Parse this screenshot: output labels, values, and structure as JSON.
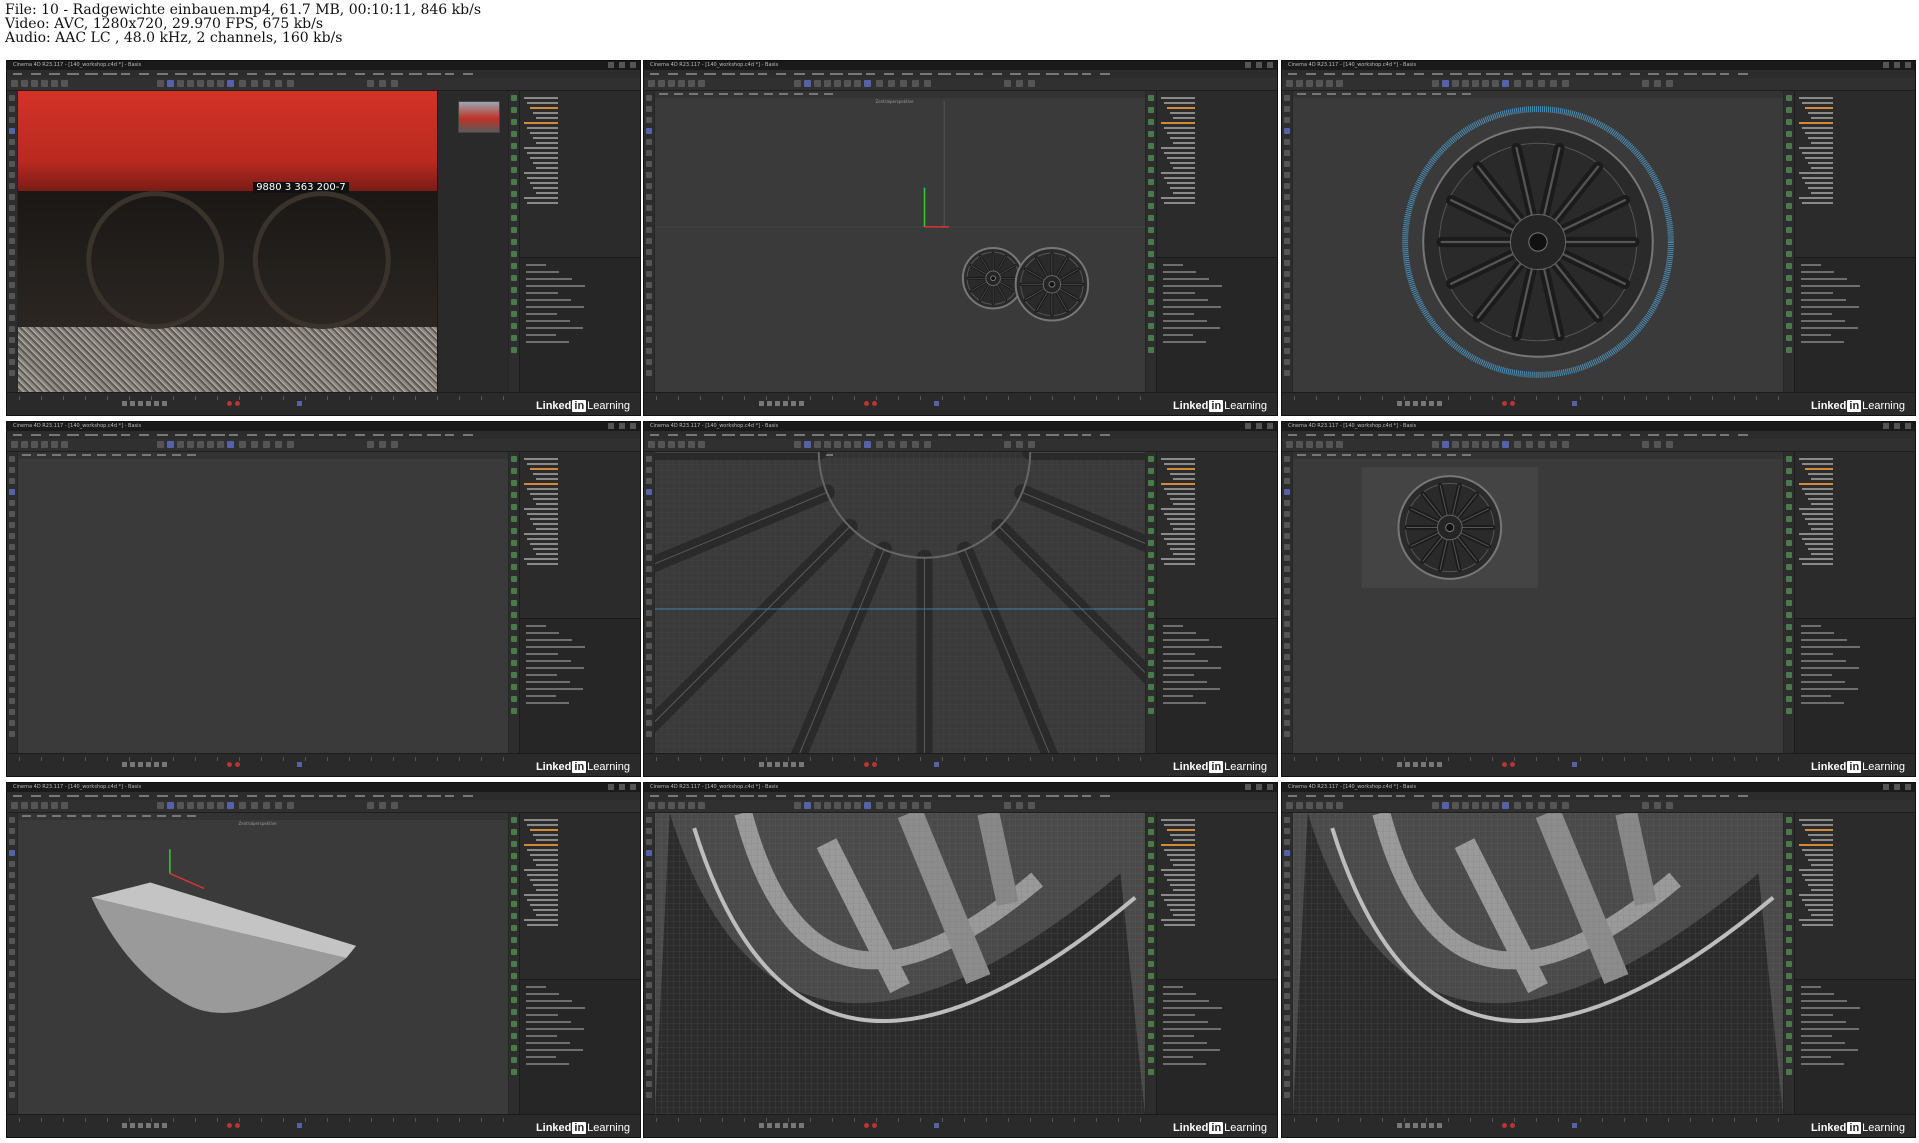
{
  "file_info": {
    "line1": "File: 10 - Radgewichte einbauen.mp4, 61.7 MB, 00:10:11, 846 kb/s",
    "line2": "Video: AVC, 1280x720, 29.970 FPS, 675 kb/s",
    "line3": "Audio: AAC LC , 48.0 kHz, 2 channels, 160 kb/s"
  },
  "watermark": {
    "brand_left": "Linked",
    "brand_box": "in",
    "brand_right": "Learning"
  },
  "frames": [
    {
      "id": "frame-1",
      "title": "Cinema 4D R23.117 - [140_workshop.c4d *] - Basis",
      "scene": "photo-reference",
      "label": ""
    },
    {
      "id": "frame-2",
      "title": "Cinema 4D R23.117 - [140_workshop.c4d *] - Basis",
      "scene": "two-wheels",
      "label": "Zentralperspektive"
    },
    {
      "id": "frame-3",
      "title": "Cinema 4D R23.117 - [140_workshop.c4d *] - Basis",
      "scene": "wheel-front",
      "label": ""
    },
    {
      "id": "frame-4",
      "title": "Cinema 4D R23.117 - [140_workshop.c4d *] - Basis",
      "scene": "empty",
      "label": ""
    },
    {
      "id": "frame-5",
      "title": "Cinema 4D R23.117 - [140_workshop.c4d *] - Basis",
      "scene": "wheel-closeup",
      "label": ""
    },
    {
      "id": "frame-6",
      "title": "Cinema 4D R23.117 - [140_workshop.c4d *] - Basis",
      "scene": "wheel-small",
      "label": ""
    },
    {
      "id": "frame-7",
      "title": "Cinema 4D R23.117 - [140_workshop.c4d *] - Basis",
      "scene": "weight-shape",
      "label": "Zentralperspektive"
    },
    {
      "id": "frame-8",
      "title": "Cinema 4D R23.117 - [140_workshop.c4d *] - Basis",
      "scene": "spokes-closeup",
      "label": ""
    },
    {
      "id": "frame-9",
      "title": "Cinema 4D R23.117 - [140_workshop.c4d *] - Basis",
      "scene": "spokes-closeup-2",
      "label": ""
    }
  ],
  "photo": {
    "loco_number": "9880 3 363 200-7"
  }
}
